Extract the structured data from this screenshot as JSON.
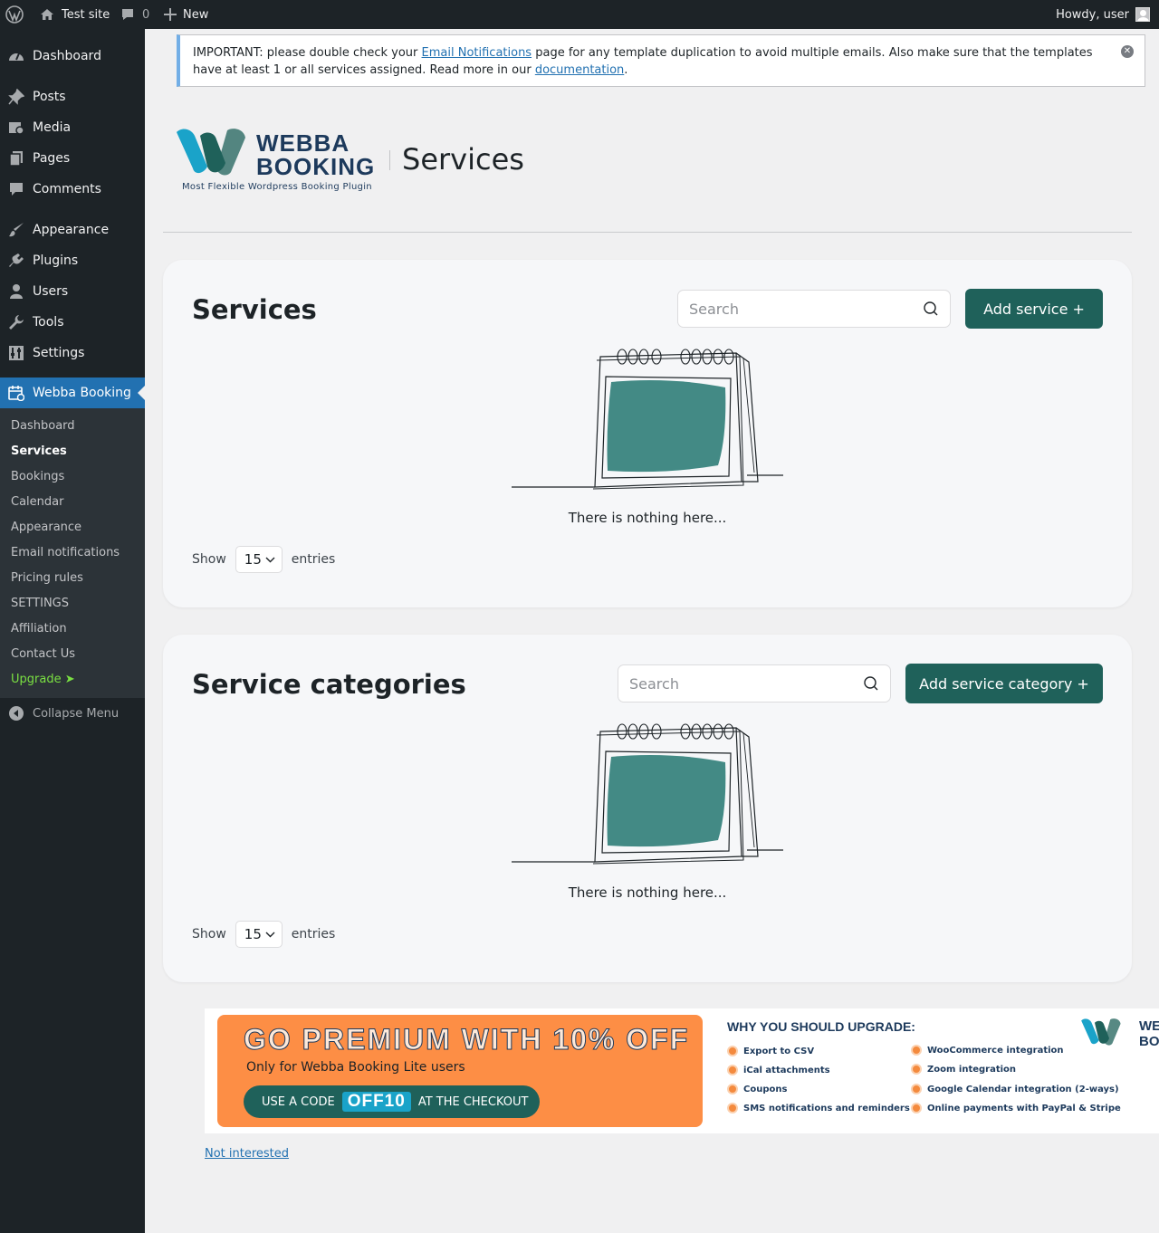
{
  "adminbar": {
    "site_name": "Test site",
    "comments_count": "0",
    "new_label": "New",
    "howdy": "Howdy, user"
  },
  "sidebar": {
    "items": [
      {
        "label": "Dashboard",
        "icon": "dashboard-icon"
      },
      {
        "label": "Posts",
        "icon": "pin-icon"
      },
      {
        "label": "Media",
        "icon": "media-icon"
      },
      {
        "label": "Pages",
        "icon": "pages-icon"
      },
      {
        "label": "Comments",
        "icon": "comment-icon"
      },
      {
        "label": "Appearance",
        "icon": "brush-icon"
      },
      {
        "label": "Plugins",
        "icon": "plugin-icon"
      },
      {
        "label": "Users",
        "icon": "user-icon"
      },
      {
        "label": "Tools",
        "icon": "wrench-icon"
      },
      {
        "label": "Settings",
        "icon": "settings-icon"
      },
      {
        "label": "Webba Booking",
        "icon": "calendar-icon"
      }
    ],
    "submenu": [
      "Dashboard",
      "Services",
      "Bookings",
      "Calendar",
      "Appearance",
      "Email notifications",
      "Pricing rules",
      "SETTINGS",
      "Affiliation",
      "Contact Us",
      "Upgrade ➤"
    ],
    "collapse_label": "Collapse Menu"
  },
  "notice": {
    "text_1": "IMPORTANT: please double check your ",
    "link_1": "Email Notifications",
    "text_2": " page for any template duplication to avoid multiple emails. Also make sure that the templates have at least 1 or all services assigned. Read more in our ",
    "link_2": "documentation",
    "text_3": "."
  },
  "header": {
    "brand_line1": "WEBBA",
    "brand_line2": "BOOKING",
    "brand_tagline": "Most Flexible Wordpress Booking Plugin",
    "page_title": "Services"
  },
  "services_panel": {
    "title": "Services",
    "search_placeholder": "Search",
    "add_button": "Add service +",
    "empty_text": "There is nothing here...",
    "show_label": "Show",
    "entries_value": "15",
    "entries_label": "entries"
  },
  "categories_panel": {
    "title": "Service categories",
    "search_placeholder": "Search",
    "add_button": "Add service category +",
    "empty_text": "There is nothing here...",
    "show_label": "Show",
    "entries_value": "15",
    "entries_label": "entries"
  },
  "banner": {
    "promo_title": "GO PREMIUM WITH 10% OFF",
    "promo_sub": "Only for Webba Booking Lite users",
    "code_prefix": "USE A CODE",
    "code": "OFF10",
    "code_suffix": "AT THE CHECKOUT",
    "why_title": "WHY YOU SHOULD UPGRADE:",
    "features_left": [
      "Export to CSV",
      "iCal attachments",
      "Coupons",
      "SMS notifications and reminders"
    ],
    "features_right": [
      "WooCommerce integration",
      "Zoom integration",
      "Google Calendar integration (2-ways)",
      "Online payments with PayPal & Stripe"
    ],
    "logo_line1": "WEB",
    "logo_line2": "BOO",
    "not_interested": "Not interested"
  },
  "colors": {
    "accent": "#1f615a",
    "wp_blue": "#2271b1",
    "promo_orange": "#fd8e45",
    "upgrade_green": "#7ae042"
  }
}
